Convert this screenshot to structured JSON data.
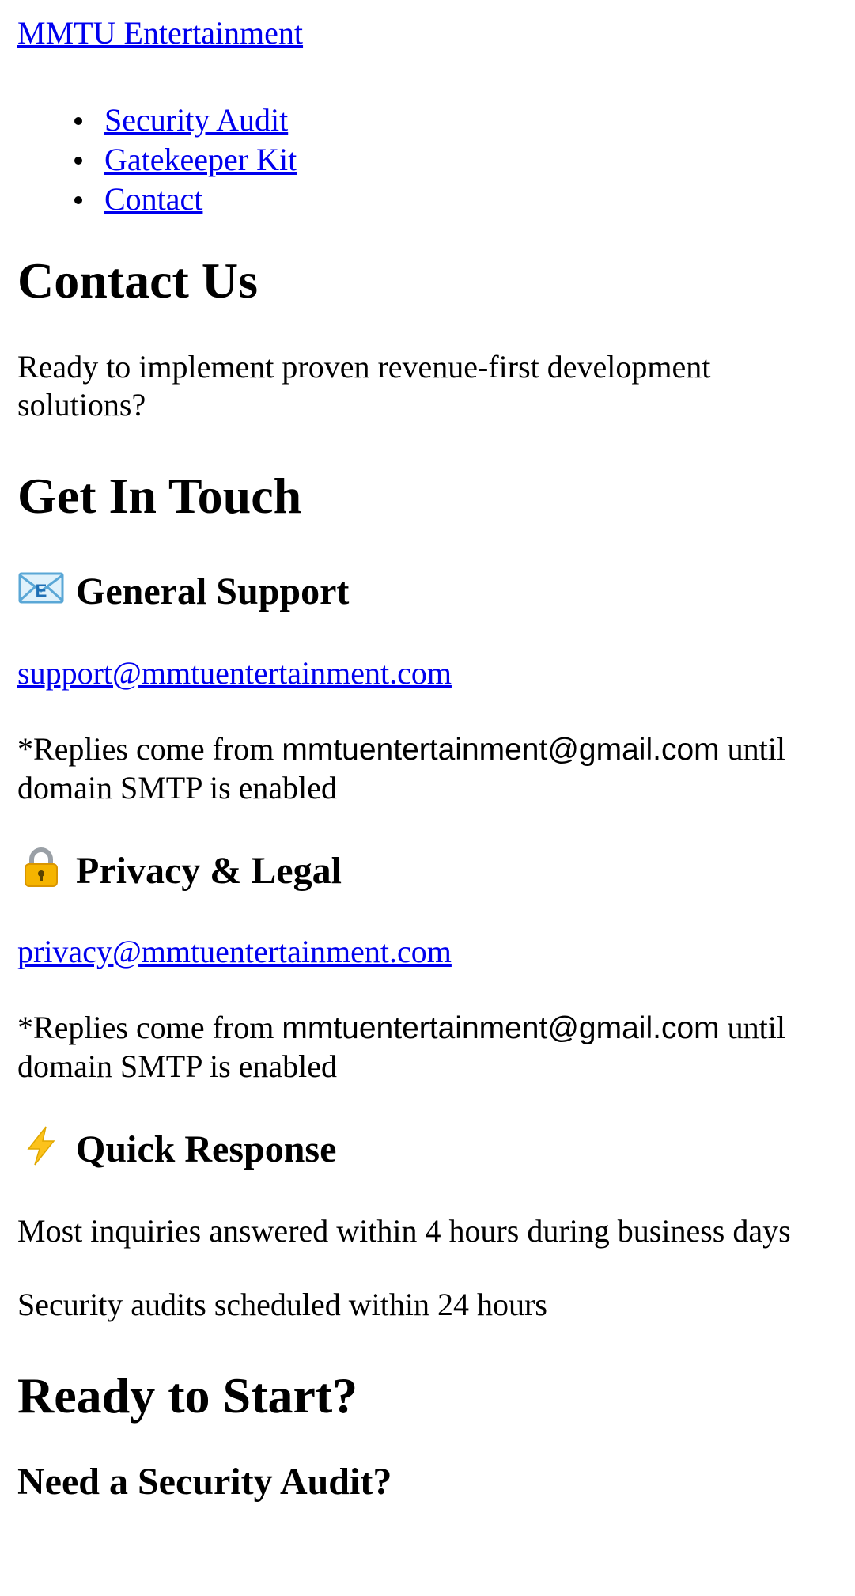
{
  "header": {
    "brand": "MMTU Entertainment",
    "nav": [
      {
        "label": "Security Audit"
      },
      {
        "label": "Gatekeeper Kit"
      },
      {
        "label": "Contact"
      }
    ]
  },
  "main": {
    "title": "Contact Us",
    "intro": "Ready to implement proven revenue-first development solutions?",
    "touch_heading": "Get In Touch",
    "general": {
      "icon": "email-icon",
      "heading": "General Support",
      "email": "support@mmtuentertainment.com",
      "note_prefix": "*Replies come from",
      "note_email": "mmtuentertainment@gmail.com",
      "note_suffix": "until domain SMTP is enabled"
    },
    "privacy": {
      "icon": "lock-icon",
      "heading": "Privacy & Legal",
      "email": "privacy@mmtuentertainment.com",
      "note_prefix": "*Replies come from",
      "note_email": "mmtuentertainment@gmail.com",
      "note_suffix": "until domain SMTP is enabled"
    },
    "quick": {
      "icon": "lightning-icon",
      "heading": "Quick Response",
      "line1": "Most inquiries answered within 4 hours during business days",
      "line2": "Security audits scheduled within 24 hours"
    },
    "ready_heading": "Ready to Start?",
    "audit_heading": "Need a Security Audit?"
  }
}
